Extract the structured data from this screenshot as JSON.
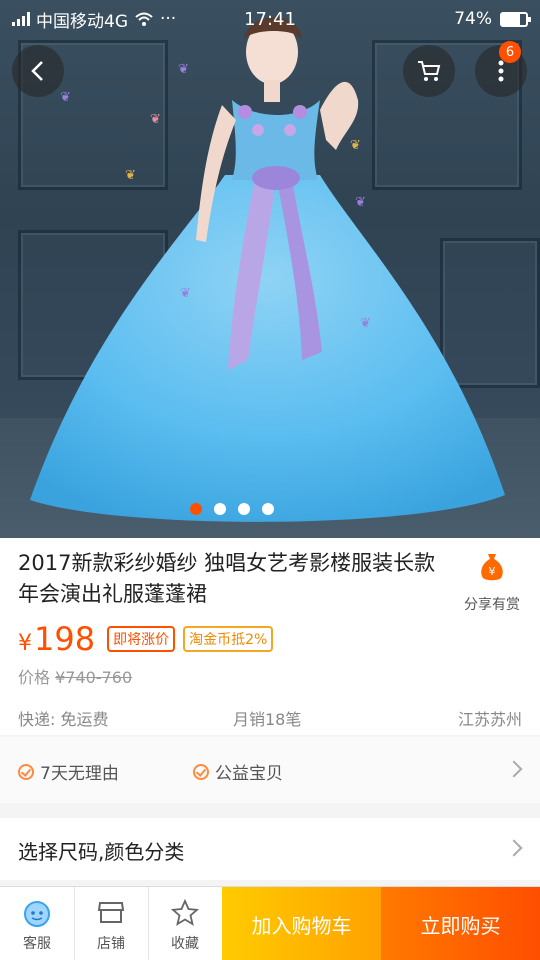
{
  "status_bar": {
    "carrier": "中国移动4G",
    "more": "···",
    "time": "17:41",
    "battery_text": "74%",
    "battery_level": 0.74
  },
  "gallery": {
    "image_count": 4,
    "active_index": 0,
    "cart_badge": "6"
  },
  "product": {
    "title": "2017新款彩纱婚纱 独唱女艺考影楼服装长款年会演出礼服蓬蓬裙",
    "share_label": "分享有赏",
    "currency": "¥",
    "price": "198",
    "tag_rising": "即将涨价",
    "tag_coin": "淘金币抵2%",
    "original_price_label": "价格",
    "original_price": "¥740-760",
    "shipping": "快递: 免运费",
    "monthly_sales": "月销18笔",
    "location": "江苏苏州"
  },
  "services": [
    {
      "label": "7天无理由"
    },
    {
      "label": "公益宝贝"
    }
  ],
  "select": {
    "label": "选择尺码,颜色分类"
  },
  "bottom_bar": {
    "service_label": "客服",
    "shop_label": "店铺",
    "fav_label": "收藏",
    "add_cart_label": "加入购物车",
    "buy_now_label": "立即购买"
  },
  "colors": {
    "accent": "#ff5000",
    "cart_button": "#ffa200",
    "buy_button": "#ff4e00"
  }
}
